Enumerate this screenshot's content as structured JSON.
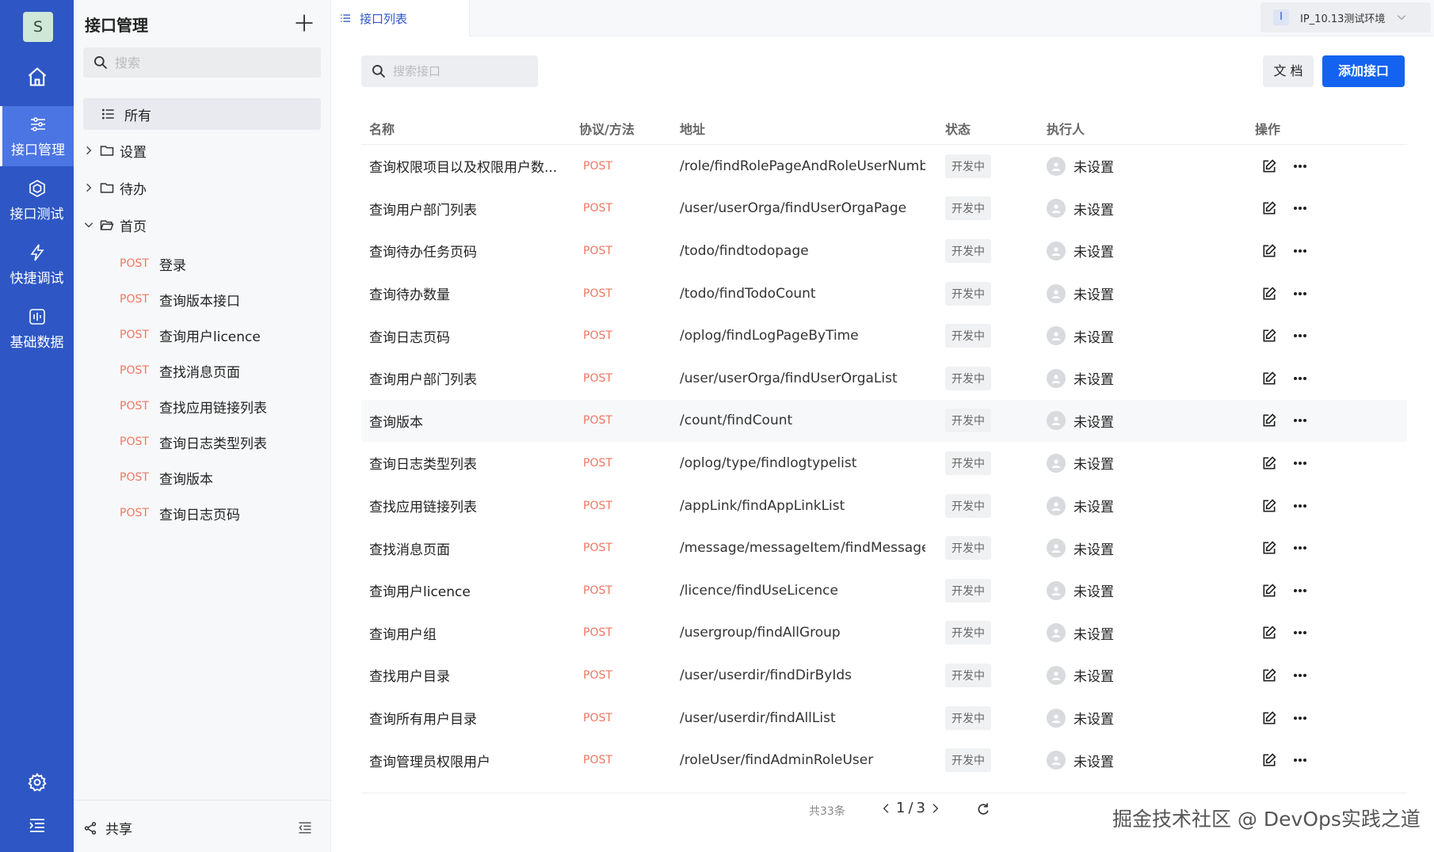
{
  "rail": {
    "logo_letter": "S",
    "items": [
      {
        "label": "接口管理",
        "icon": "sliders-icon",
        "active": true
      },
      {
        "label": "接口测试",
        "icon": "cube-icon",
        "active": false
      },
      {
        "label": "快捷调试",
        "icon": "lightning-icon",
        "active": false
      },
      {
        "label": "基础数据",
        "icon": "data-icon",
        "active": false
      }
    ]
  },
  "tree": {
    "title": "接口管理",
    "search_placeholder": "搜索",
    "all_label": "所有",
    "folders": [
      {
        "label": "设置",
        "expanded": false
      },
      {
        "label": "待办",
        "expanded": false
      },
      {
        "label": "首页",
        "expanded": true
      }
    ],
    "nodes": [
      {
        "method": "POST",
        "label": "登录"
      },
      {
        "method": "POST",
        "label": "查询版本接口"
      },
      {
        "method": "POST",
        "label": "查询用户licence"
      },
      {
        "method": "POST",
        "label": "查找消息页面"
      },
      {
        "method": "POST",
        "label": "查找应用链接列表"
      },
      {
        "method": "POST",
        "label": "查询日志类型列表"
      },
      {
        "method": "POST",
        "label": "查询版本"
      },
      {
        "method": "POST",
        "label": "查询日志页码"
      }
    ],
    "share_label": "共享"
  },
  "topbar": {
    "tab_label": "接口列表",
    "env_badge": "I",
    "env_label": "IP_10.13测试环境"
  },
  "main": {
    "search_placeholder": "搜索接口",
    "doc_button": "文 档",
    "add_button": "添加接口",
    "columns": [
      "名称",
      "协议/方法",
      "地址",
      "状态",
      "执行人",
      "操作"
    ],
    "rows": [
      {
        "name": "查询权限项目以及权限用户数...",
        "method": "POST",
        "path": "/role/findRolePageAndRoleUserNumber",
        "status": "开发中",
        "owner": "未设置"
      },
      {
        "name": "查询用户部门列表",
        "method": "POST",
        "path": "/user/userOrga/findUserOrgaPage",
        "status": "开发中",
        "owner": "未设置"
      },
      {
        "name": "查询待办任务页码",
        "method": "POST",
        "path": "/todo/findtodopage",
        "status": "开发中",
        "owner": "未设置"
      },
      {
        "name": "查询待办数量",
        "method": "POST",
        "path": "/todo/findTodoCount",
        "status": "开发中",
        "owner": "未设置"
      },
      {
        "name": "查询日志页码",
        "method": "POST",
        "path": "/oplog/findLogPageByTime",
        "status": "开发中",
        "owner": "未设置"
      },
      {
        "name": "查询用户部门列表",
        "method": "POST",
        "path": "/user/userOrga/findUserOrgaList",
        "status": "开发中",
        "owner": "未设置"
      },
      {
        "name": "查询版本",
        "method": "POST",
        "path": "/count/findCount",
        "status": "开发中",
        "owner": "未设置"
      },
      {
        "name": "查询日志类型列表",
        "method": "POST",
        "path": "/oplog/type/findlogtypelist",
        "status": "开发中",
        "owner": "未设置"
      },
      {
        "name": "查找应用链接列表",
        "method": "POST",
        "path": "/appLink/findAppLinkList",
        "status": "开发中",
        "owner": "未设置"
      },
      {
        "name": "查找消息页面",
        "method": "POST",
        "path": "/message/messageItem/findMessageI...",
        "status": "开发中",
        "owner": "未设置"
      },
      {
        "name": "查询用户licence",
        "method": "POST",
        "path": "/licence/findUseLicence",
        "status": "开发中",
        "owner": "未设置"
      },
      {
        "name": "查询用户组",
        "method": "POST",
        "path": "/usergroup/findAllGroup",
        "status": "开发中",
        "owner": "未设置"
      },
      {
        "name": "查找用户目录",
        "method": "POST",
        "path": "/user/userdir/findDirByIds",
        "status": "开发中",
        "owner": "未设置"
      },
      {
        "name": "查询所有用户目录",
        "method": "POST",
        "path": "/user/userdir/findAllList",
        "status": "开发中",
        "owner": "未设置"
      },
      {
        "name": "查询管理员权限用户",
        "method": "POST",
        "path": "/roleUser/findAdminRoleUser",
        "status": "开发中",
        "owner": "未设置"
      }
    ],
    "highlighted_row": 6,
    "pagination": {
      "total": "共33条",
      "current": "1",
      "sep": "/",
      "pages": "3"
    }
  },
  "watermark": "掘金技术社区 @ DevOps实践之道",
  "colors": {
    "rail": "#2e57c5",
    "rail_active": "#4b75e3",
    "primary": "#1463f0",
    "method": "#ef7663"
  }
}
